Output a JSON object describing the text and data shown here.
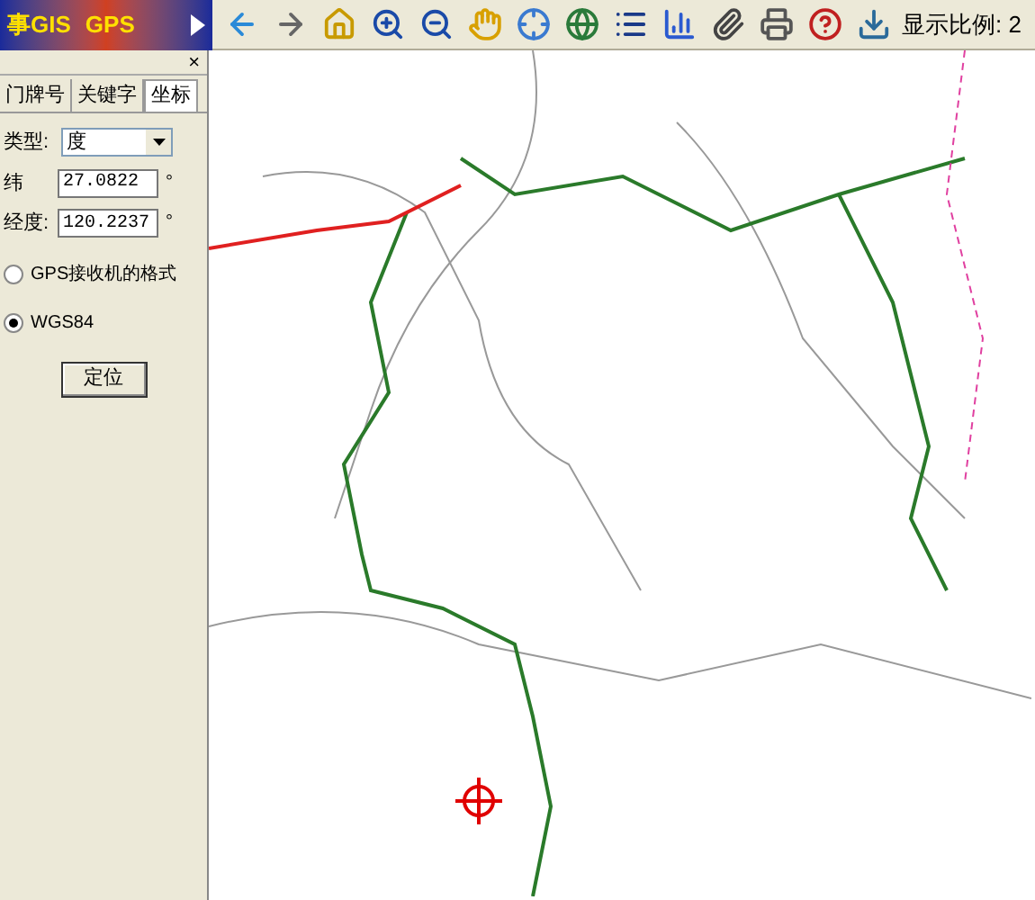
{
  "logo": {
    "title": "事GIS",
    "subtitle": "GPS"
  },
  "toolbar": {
    "scale_label": "显示比例: 2"
  },
  "panel": {
    "close": "×",
    "tabs": [
      {
        "label": "门牌号",
        "selected": false
      },
      {
        "label": "关键字",
        "selected": false
      },
      {
        "label": "坐标",
        "selected": true
      }
    ],
    "type_label": "类型:",
    "type_value": "度",
    "lat_label": "纬",
    "lat_value": "27.0822",
    "lat_unit": "°",
    "lon_label": "经度:",
    "lon_value": "120.2237",
    "lon_unit": "°",
    "formats": [
      {
        "label": "GPS接收机的格式",
        "selected": false
      },
      {
        "label": "WGS84",
        "selected": true
      }
    ],
    "locate_button": "定位"
  }
}
